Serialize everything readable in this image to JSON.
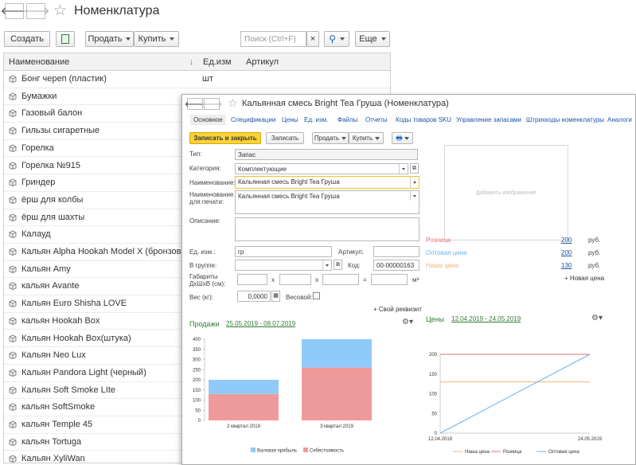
{
  "main": {
    "title": "Номенклатура",
    "toolbar": {
      "create": "Создать",
      "sell": "Продать",
      "buy": "Купить",
      "search_placeholder": "Поиск (Ctrl+F)",
      "clear": "×",
      "more": "Еще"
    },
    "columns": [
      "Наименование",
      "Ед.изм",
      "Артикул"
    ],
    "rows": [
      {
        "name": "Бонг череп (пластик)",
        "unit": "шт"
      },
      {
        "name": "Бумажки",
        "unit": ""
      },
      {
        "name": "Газовый балон",
        "unit": ""
      },
      {
        "name": "Гильзы сигаретные",
        "unit": ""
      },
      {
        "name": "Горелка",
        "unit": ""
      },
      {
        "name": "Горелка №915",
        "unit": ""
      },
      {
        "name": "Гриндер",
        "unit": ""
      },
      {
        "name": "ёрш для колбы",
        "unit": ""
      },
      {
        "name": "ёрш для шахты",
        "unit": ""
      },
      {
        "name": "Калауд",
        "unit": ""
      },
      {
        "name": "Кальян Alpha Hookah Model X (бронзовый)",
        "unit": ""
      },
      {
        "name": "Кальян Amy",
        "unit": ""
      },
      {
        "name": "кальян Avante",
        "unit": ""
      },
      {
        "name": "Кальян Euro Shisha LOVE",
        "unit": ""
      },
      {
        "name": "кальян Hookah Box",
        "unit": ""
      },
      {
        "name": "Кальян Hookah Box(штука)",
        "unit": ""
      },
      {
        "name": "Кальян Neo Lux",
        "unit": ""
      },
      {
        "name": "Кальян Pandora Light (черный)",
        "unit": ""
      },
      {
        "name": "Кальян Soft Smoke LIte",
        "unit": ""
      },
      {
        "name": "кальян SoftSmoke",
        "unit": ""
      },
      {
        "name": "кальян Temple 45",
        "unit": ""
      },
      {
        "name": "кальян Tortuga",
        "unit": ""
      },
      {
        "name": "Кальян XyliWan",
        "unit": ""
      }
    ]
  },
  "form": {
    "title": "Кальянная смесь Bright Tea Груша (Номенклатура)",
    "tabs": [
      "Основное",
      "Спецификации",
      "Цены",
      "Ед. изм.",
      "Файлы",
      "Отчеты",
      "Коды товаров SKU",
      "Управление запасами",
      "Штрихкоды номенклатуры",
      "Аналоги"
    ],
    "buttons": {
      "save_close": "Записать и закрыть",
      "save": "Записать",
      "sell": "Продать",
      "buy": "Купить"
    },
    "fields": {
      "type_label": "Тип:",
      "type_value": "Запас",
      "category_label": "Категория:",
      "category_value": "Комплектующие",
      "name_label": "Наименование:",
      "name_value": "Кальянная смесь Bright Tea Груша",
      "print_name_label": "Наименование для печати:",
      "print_name_value": "Кальянная смесь Bright Tea Груша",
      "description_label": "Описание:",
      "unit_label": "Ед. изм.:",
      "unit_value": "гр",
      "article_label": "Артикул:",
      "group_label": "В группе:",
      "code_label": "Код:",
      "code_value": "00-00000163",
      "dims_label": "Габариты ДxШxВ (см):",
      "dims_x1": "x",
      "dims_x2": "x",
      "dims_eq": "=",
      "dims_unit": "м³",
      "weight_label": "Вес (кг):",
      "weight_value": "0,0000",
      "weighted_label": "Весовой:",
      "custom_attr": "+ Свой реквизит",
      "add_image": "Добавить изображение"
    },
    "prices": [
      {
        "name": "Розница",
        "value": "200",
        "currency": "руб.",
        "color": "#e57373"
      },
      {
        "name": "Оптовая цена",
        "value": "200",
        "currency": "руб.",
        "color": "#64b5f6"
      },
      {
        "name": "Наша цена",
        "value": "130",
        "currency": "руб.",
        "color": "#f6b26b"
      }
    ],
    "new_price": "+ Новая цена",
    "sales_title": "Продажи",
    "sales_period": "25.05.2019 - 08.07.2019",
    "prices_title": "Цены",
    "prices_period": "12.04.2019 - 24.05.2019"
  },
  "chart_data": [
    {
      "type": "bar",
      "stacked": true,
      "categories": [
        "2 квартал 2019",
        "3 квартал 2019"
      ],
      "series": [
        {
          "name": "Себестоимость",
          "values": [
            130,
            260
          ],
          "color": "#ef9a9a"
        },
        {
          "name": "Валовая прибыль",
          "values": [
            70,
            140
          ],
          "color": "#90caf9"
        }
      ],
      "yticks": [
        0,
        50,
        100,
        150,
        200,
        250,
        300,
        350,
        400
      ],
      "ylim": [
        0,
        400
      ],
      "legend": "bottom"
    },
    {
      "type": "line",
      "x": [
        "12.04.2019",
        "24.05.2019"
      ],
      "series": [
        {
          "name": "Наша цена",
          "values": [
            130,
            130
          ],
          "color": "#f6b26b"
        },
        {
          "name": "Розница",
          "values": [
            200,
            200
          ],
          "color": "#e57373"
        },
        {
          "name": "Оптовая цена",
          "values": [
            0,
            200
          ],
          "color": "#64b5f6"
        }
      ],
      "yticks": [
        0,
        50,
        100,
        150,
        200
      ],
      "ylim": [
        0,
        200
      ],
      "legend": "bottom"
    }
  ]
}
